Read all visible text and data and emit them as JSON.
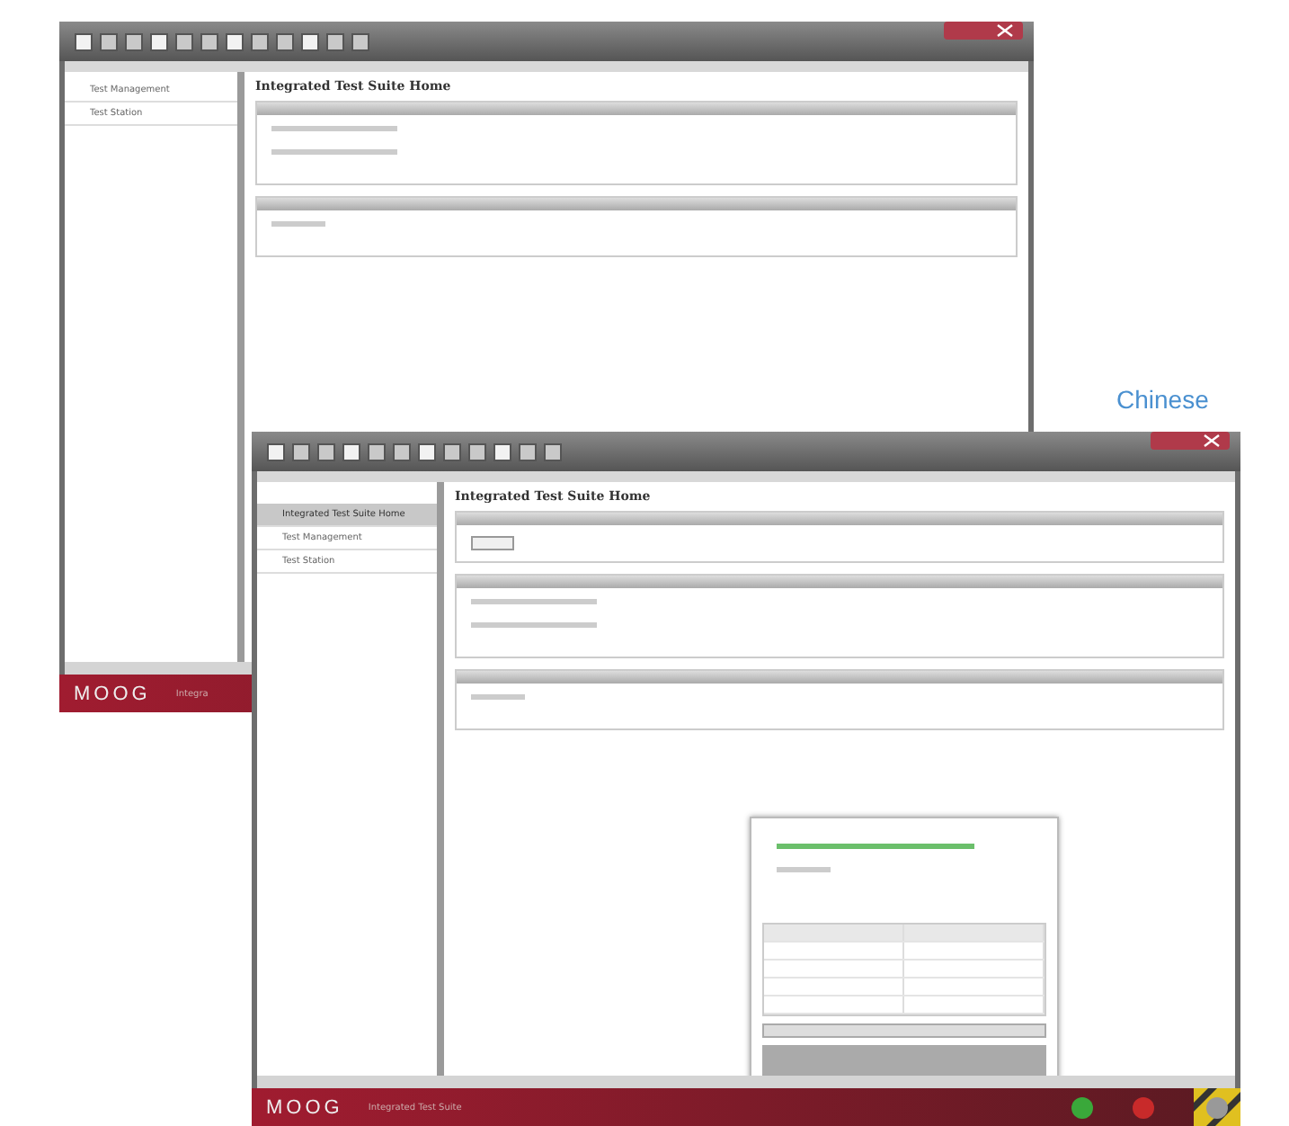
{
  "label": "Chinese",
  "windows": [
    {
      "kind": "back",
      "tree": [
        {
          "label": "Test Management",
          "selected": false
        },
        {
          "label": "Test Station",
          "selected": false
        }
      ],
      "heading": "Integrated Test Suite Home",
      "sections": [
        {
          "kind": "rows"
        },
        {
          "kind": "row"
        }
      ],
      "footer": {
        "logo": "MOOG",
        "app_name": "Integra"
      }
    },
    {
      "kind": "front",
      "tree": [
        {
          "label": "Integrated Test Suite Home",
          "selected": true
        },
        {
          "label": "Test Management",
          "selected": false
        },
        {
          "label": "Test Station",
          "selected": false
        }
      ],
      "heading": "Integrated Test Suite Home",
      "sections": [
        {
          "kind": "button"
        },
        {
          "kind": "rows"
        },
        {
          "kind": "row"
        }
      ],
      "footer": {
        "logo": "MOOG",
        "app_name": "Integrated Test Suite"
      },
      "status": [
        {
          "color": "#3aa83a"
        },
        {
          "color": "#c82a2a"
        }
      ]
    }
  ]
}
